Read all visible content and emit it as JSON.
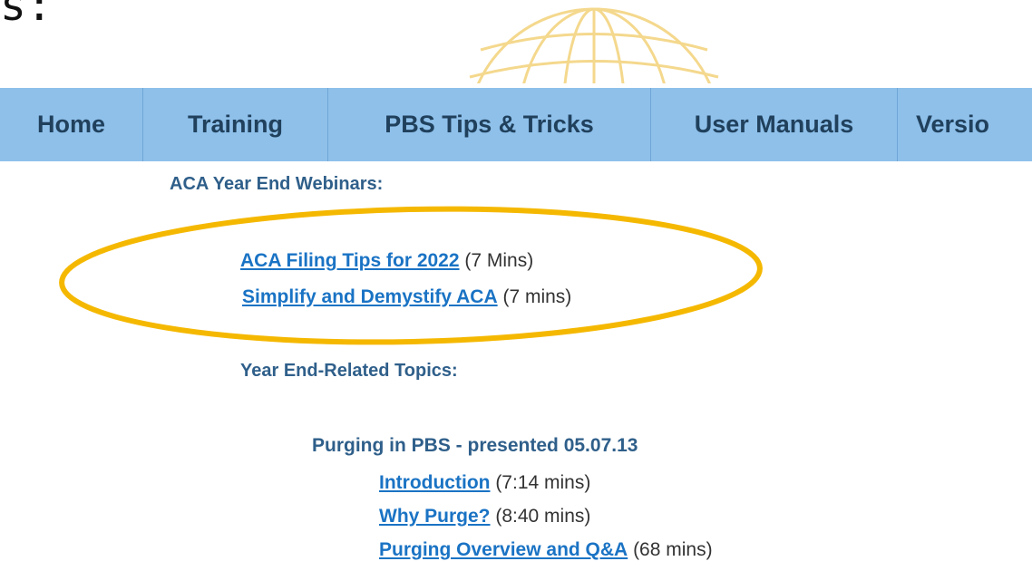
{
  "slide": {
    "text_fragment": "s:"
  },
  "nav": {
    "items": [
      {
        "label": "Home"
      },
      {
        "label": "Training"
      },
      {
        "label": "PBS Tips & Tricks"
      },
      {
        "label": "User Manuals"
      },
      {
        "label": "Versio"
      }
    ]
  },
  "sections": {
    "aca": {
      "heading": "ACA Year End Webinars:",
      "links": [
        {
          "label": "ACA Filing Tips for 2022",
          "duration": " (7 Mins)"
        },
        {
          "label": "Simplify and Demystify ACA",
          "duration": " (7 mins)"
        }
      ]
    },
    "year_end": {
      "heading": "Year End-Related Topics:",
      "subheading": "Purging in PBS - presented 05.07.13",
      "links": [
        {
          "label": "Introduction",
          "duration": " (7:14 mins)"
        },
        {
          "label": "Why Purge?",
          "duration": " (8:40 mins)"
        },
        {
          "label": "Purging Overview and Q&A",
          "duration": " (68 mins)"
        }
      ]
    }
  },
  "colors": {
    "nav_bg": "#8ec0ea",
    "nav_text": "#20405c",
    "heading": "#2f5f8a",
    "link": "#1a73c4",
    "ellipse": "#f5b800",
    "globe": "#f3d27a"
  },
  "icons": {
    "logo": "globe-icon"
  }
}
